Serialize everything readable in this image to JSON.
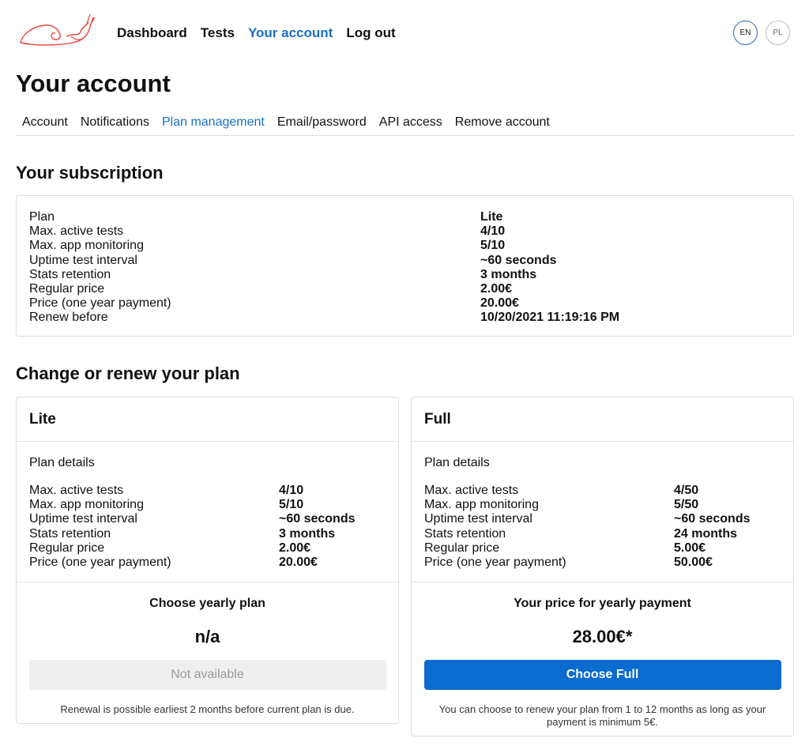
{
  "header": {
    "nav": [
      "Dashboard",
      "Tests",
      "Your account",
      "Log out"
    ],
    "lang_en": "EN",
    "lang_pl": "PL"
  },
  "page_title": "Your account",
  "tabs": [
    "Account",
    "Notifications",
    "Plan management",
    "Email/password",
    "API access",
    "Remove account"
  ],
  "subscription": {
    "title": "Your subscription",
    "rows": [
      {
        "k": "Plan",
        "v": "Lite"
      },
      {
        "k": "Max. active tests",
        "v": "4/10"
      },
      {
        "k": "Max. app monitoring",
        "v": "5/10"
      },
      {
        "k": "Uptime test interval",
        "v": "~60 seconds"
      },
      {
        "k": "Stats retention",
        "v": "3 months"
      },
      {
        "k": "Regular price",
        "v": "2.00€"
      },
      {
        "k": "Price (one year payment)",
        "v": "20.00€"
      },
      {
        "k": "Renew before",
        "v": "10/20/2021 11:19:16 PM"
      }
    ]
  },
  "change": {
    "title": "Change or renew your plan",
    "lite": {
      "name": "Lite",
      "details_label": "Plan details",
      "rows": [
        {
          "k": "Max. active tests",
          "v": "4/10"
        },
        {
          "k": "Max. app monitoring",
          "v": "5/10"
        },
        {
          "k": "Uptime test interval",
          "v": "~60 seconds"
        },
        {
          "k": "Stats retention",
          "v": "3 months"
        },
        {
          "k": "Regular price",
          "v": "2.00€"
        },
        {
          "k": "Price (one year payment)",
          "v": "20.00€"
        }
      ],
      "foot_title": "Choose yearly plan",
      "price": "n/a",
      "button": "Not available",
      "note": "Renewal is possible earliest 2 months before current plan is due."
    },
    "full": {
      "name": "Full",
      "details_label": "Plan details",
      "rows": [
        {
          "k": "Max. active tests",
          "v": "4/50"
        },
        {
          "k": "Max. app monitoring",
          "v": "5/50"
        },
        {
          "k": "Uptime test interval",
          "v": "~60 seconds"
        },
        {
          "k": "Stats retention",
          "v": "24 months"
        },
        {
          "k": "Regular price",
          "v": "5.00€"
        },
        {
          "k": "Price (one year payment)",
          "v": "50.00€"
        }
      ],
      "foot_title": "Your price for yearly payment",
      "price": "28.00€*",
      "button": "Choose Full",
      "note": "You can choose to renew your plan from 1 to 12 months as long as your payment is minimum 5€."
    }
  },
  "colors": {
    "accent": "#1a6fc4",
    "primary_button": "#0a6bd0",
    "logo": "#e8453c"
  }
}
